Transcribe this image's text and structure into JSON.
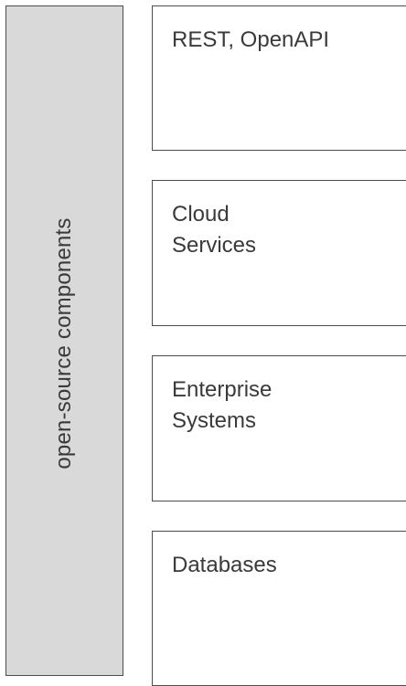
{
  "sidebar": {
    "label": "open-source components"
  },
  "boxes": [
    {
      "label": "REST, OpenAPI"
    },
    {
      "label": "Cloud\nServices"
    },
    {
      "label": "Enterprise\nSystems"
    },
    {
      "label": "Databases"
    }
  ]
}
